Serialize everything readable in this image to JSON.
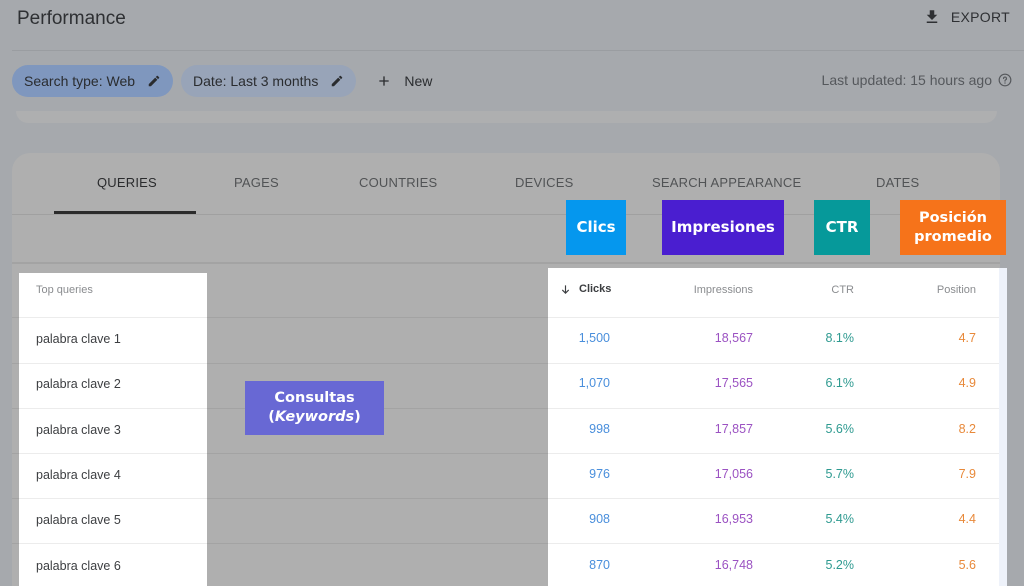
{
  "header": {
    "title": "Performance",
    "export_label": "EXPORT"
  },
  "filters": {
    "chips": [
      {
        "label": "Search type: Web",
        "active": true
      },
      {
        "label": "Date: Last 3 months",
        "active": false
      }
    ],
    "new_label": "New",
    "last_updated": "Last updated: 15 hours ago"
  },
  "tabs": [
    {
      "label": "QUERIES",
      "active": true
    },
    {
      "label": "PAGES",
      "active": false
    },
    {
      "label": "COUNTRIES",
      "active": false
    },
    {
      "label": "DEVICES",
      "active": false
    },
    {
      "label": "SEARCH APPEARANCE",
      "active": false
    },
    {
      "label": "DATES",
      "active": false
    }
  ],
  "table": {
    "columns": {
      "query": "Top queries",
      "clicks": "Clicks",
      "impressions": "Impressions",
      "ctr": "CTR",
      "position": "Position"
    },
    "sort": {
      "column": "clicks",
      "direction": "descending"
    },
    "rows": [
      {
        "query": "palabra clave 1",
        "clicks": "1,500",
        "impressions": "18,567",
        "ctr": "8.1%",
        "position": "4.7"
      },
      {
        "query": "palabra clave 2",
        "clicks": "1,070",
        "impressions": "17,565",
        "ctr": "6.1%",
        "position": "4.9"
      },
      {
        "query": "palabra clave 3",
        "clicks": "998",
        "impressions": "17,857",
        "ctr": "5.6%",
        "position": "8.2"
      },
      {
        "query": "palabra clave 4",
        "clicks": "976",
        "impressions": "17,056",
        "ctr": "5.7%",
        "position": "7.9"
      },
      {
        "query": "palabra clave 5",
        "clicks": "908",
        "impressions": "16,953",
        "ctr": "5.4%",
        "position": "4.4"
      },
      {
        "query": "palabra clave 6",
        "clicks": "870",
        "impressions": "16,748",
        "ctr": "5.2%",
        "position": "5.6"
      }
    ]
  },
  "annotations": {
    "clicks": "Clics",
    "impressions": "Impresiones",
    "ctr": "CTR",
    "position_line1": "Posición",
    "position_line2": "promedio",
    "keywords_line1": "Consultas",
    "keywords_open": "(",
    "keywords_italic": "Keywords",
    "keywords_close": ")"
  },
  "colors": {
    "clicks": "#4a8fdc",
    "impressions": "#9b52c2",
    "ctr": "#2e9a90",
    "position": "#e8893a",
    "anno_clicks": "#0597ee",
    "anno_impressions": "#4a1ed0",
    "anno_ctr": "#06999a",
    "anno_position": "#f6731a",
    "anno_keywords": "#6868d4"
  }
}
